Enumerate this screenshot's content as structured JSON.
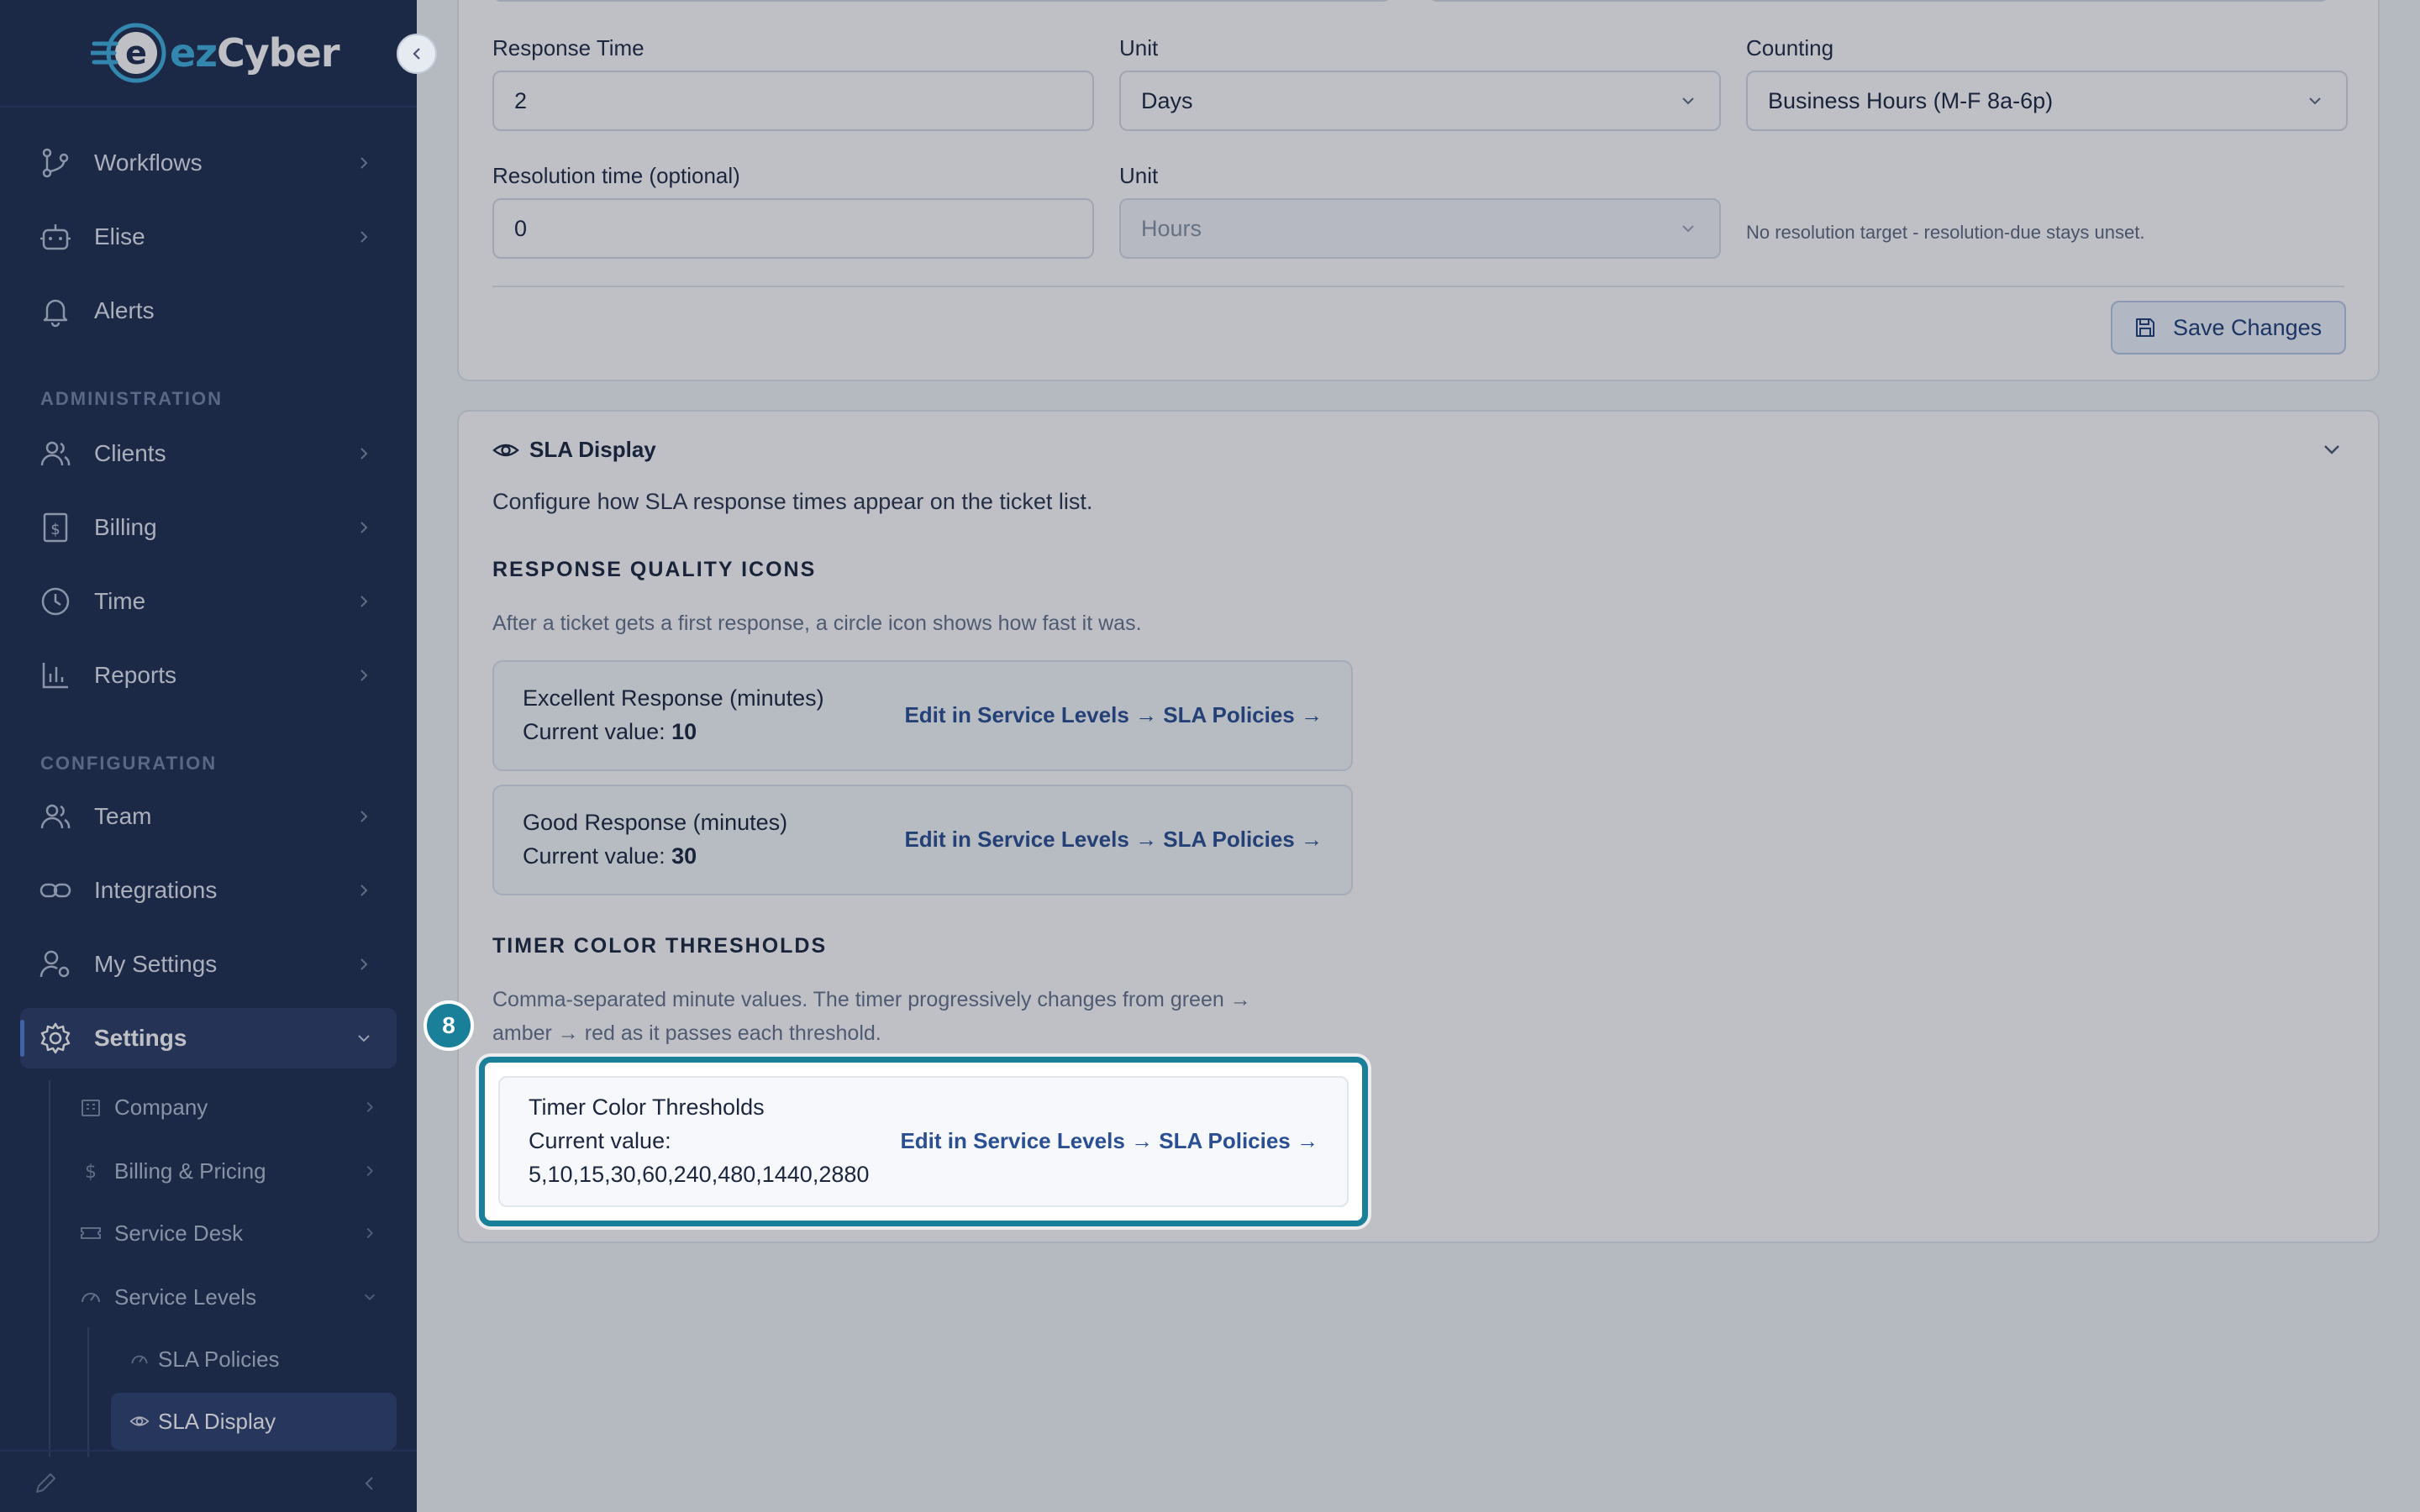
{
  "brand": {
    "name_prefix": "ez",
    "name_suffix": "Cyber"
  },
  "sidebar": {
    "main_items": [
      {
        "label": "Workflows",
        "icon": "workflow-icon"
      },
      {
        "label": "Elise",
        "icon": "bot-icon"
      },
      {
        "label": "Alerts",
        "icon": "bell-icon"
      }
    ],
    "administration_header": "ADMINISTRATION",
    "administration_items": [
      {
        "label": "Clients",
        "icon": "users-icon"
      },
      {
        "label": "Billing",
        "icon": "receipt-icon"
      },
      {
        "label": "Time",
        "icon": "clock-icon"
      },
      {
        "label": "Reports",
        "icon": "bar-chart-icon"
      }
    ],
    "configuration_header": "CONFIGURATION",
    "configuration_items": [
      {
        "label": "Team",
        "icon": "users-icon"
      },
      {
        "label": "Integrations",
        "icon": "link-icon"
      },
      {
        "label": "My Settings",
        "icon": "user-cog-icon"
      },
      {
        "label": "Settings",
        "icon": "gear-icon",
        "active": true
      }
    ],
    "settings_subitems": [
      {
        "label": "Company",
        "icon": "building-icon"
      },
      {
        "label": "Billing & Pricing",
        "icon": "dollar-icon"
      },
      {
        "label": "Service Desk",
        "icon": "ticket-icon"
      },
      {
        "label": "Service Levels",
        "icon": "gauge-icon",
        "expanded": true
      }
    ],
    "service_level_subitems": [
      {
        "label": "SLA Policies",
        "icon": "gauge-icon"
      },
      {
        "label": "SLA Display",
        "icon": "eye-icon",
        "active": true
      }
    ]
  },
  "sla_form": {
    "response_time_label": "Response Time",
    "response_time_value": "2",
    "response_unit_label": "Unit",
    "response_unit_value": "Days",
    "counting_label": "Counting",
    "counting_value": "Business Hours (M-F 8a-6p)",
    "resolution_label": "Resolution time (optional)",
    "resolution_value": "0",
    "resolution_unit_label": "Unit",
    "resolution_unit_value": "Hours",
    "resolution_hint": "No resolution target - resolution-due stays unset.",
    "save_label": "Save Changes"
  },
  "sla_display": {
    "title": "SLA Display",
    "description": "Configure how SLA response times appear on the ticket list.",
    "quality_header": "RESPONSE QUALITY ICONS",
    "quality_desc": "After a ticket gets a first response, a circle icon shows how fast it was.",
    "excellent": {
      "title": "Excellent Response (minutes)",
      "prefix": "Current value: ",
      "value": "10",
      "link": "Edit in Service Levels → SLA Policies →"
    },
    "good": {
      "title": "Good Response (minutes)",
      "prefix": "Current value: ",
      "value": "30",
      "link": "Edit in Service Levels → SLA Policies →"
    },
    "timer_header": "TIMER COLOR THRESHOLDS",
    "timer_desc_line1": "Comma-separated minute values. The timer progressively changes from green →",
    "timer_desc_line2": "amber → red as it passes each threshold.",
    "timer": {
      "title": "Timer Color Thresholds",
      "prefix": "Current value:",
      "value": "5,10,15,30,60,240,480,1440,2880",
      "link": "Edit in Service Levels → SLA Policies →"
    }
  },
  "tour": {
    "step": "8",
    "accent": "#1a7f99"
  }
}
